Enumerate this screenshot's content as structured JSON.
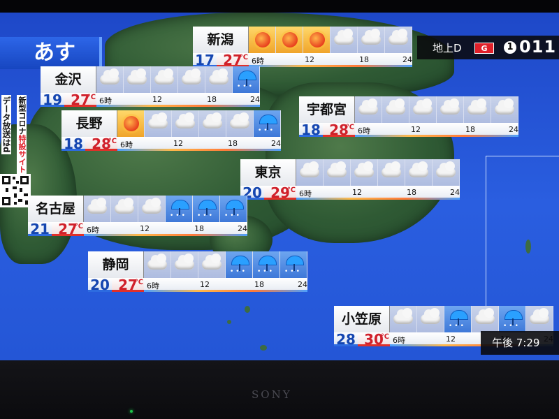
{
  "title": "あす",
  "channel": {
    "label": "地上D",
    "badge": "G",
    "circle": "1",
    "number": "011"
  },
  "clock": "午後 7:29",
  "side_notice": {
    "line1_pre": "新型コロナ",
    "line1_hl": "特設サイト",
    "line2": "データ放送はd"
  },
  "brand": "SONY",
  "degree_unit": "℃",
  "time_labels": [
    "6時",
    "12",
    "18",
    "24"
  ],
  "colors": {
    "sea": "#2a5ee0",
    "min_temp": "#1546b0",
    "max_temp": "#d0202a"
  },
  "panels": [
    {
      "id": "niigata",
      "name": "新潟",
      "min": "17",
      "max": "27",
      "icons": [
        "sun-icon",
        "sun-icon",
        "sun-icon",
        "cloud-icon",
        "cloud-icon",
        "cloud-icon"
      ]
    },
    {
      "id": "kanazawa",
      "name": "金沢",
      "min": "19",
      "max": "27",
      "icons": [
        "cloud-icon",
        "cloud-icon",
        "cloud-icon",
        "cloud-icon",
        "cloud-icon",
        "umbrella-rain-icon"
      ]
    },
    {
      "id": "nagano",
      "name": "長野",
      "min": "18",
      "max": "28",
      "icons": [
        "sun-icon",
        "cloud-icon",
        "cloud-icon",
        "cloud-icon",
        "cloud-icon",
        "umbrella-rain-icon"
      ]
    },
    {
      "id": "utsunomiya",
      "name": "宇都宮",
      "min": "18",
      "max": "28",
      "icons": [
        "cloud-icon",
        "cloud-icon",
        "cloud-icon",
        "cloud-icon",
        "cloud-icon",
        "cloud-icon"
      ]
    },
    {
      "id": "tokyo",
      "name": "東京",
      "min": "20",
      "max": "29",
      "icons": [
        "cloud-icon",
        "cloud-icon",
        "cloud-icon",
        "cloud-icon",
        "cloud-icon",
        "cloud-icon"
      ]
    },
    {
      "id": "nagoya",
      "name": "名古屋",
      "min": "21",
      "max": "27",
      "icons": [
        "cloud-icon",
        "cloud-icon",
        "cloud-icon",
        "umbrella-rain-icon",
        "umbrella-rain-icon",
        "umbrella-rain-icon"
      ]
    },
    {
      "id": "shizuoka",
      "name": "静岡",
      "min": "20",
      "max": "27",
      "icons": [
        "cloud-icon",
        "cloud-icon",
        "cloud-icon",
        "umbrella-rain-icon",
        "umbrella-rain-icon",
        "umbrella-rain-icon"
      ]
    },
    {
      "id": "ogasawara",
      "name": "小笠原",
      "min": "28",
      "max": "30",
      "icons": [
        "cloud-icon",
        "cloud-icon",
        "umbrella-rain-icon",
        "cloud-icon",
        "umbrella-rain-icon",
        "cloud-icon"
      ]
    }
  ]
}
